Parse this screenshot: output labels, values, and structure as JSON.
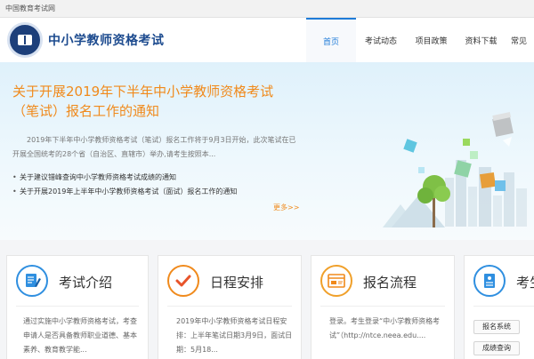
{
  "topbar": {
    "site_name": "中国教育考试网"
  },
  "header": {
    "title": "中小学教师资格考试"
  },
  "nav": {
    "items": [
      "首页",
      "考试动态",
      "项目政策",
      "资料下载",
      "常见"
    ]
  },
  "banner": {
    "headline": "关于开展2019年下半年中小学教师资格考试（笔试）报名工作的通知",
    "summary": "2019年下半年中小学教师资格考试（笔试）报名工作将于9月3日开始，此次笔试在已开展全国统考的28个省（自治区、直辖市）举办,请考生按照本...",
    "news": [
      "关于建议错峰查询中小学教师资格考试成绩的通知",
      "关于开展2019年上半年中小学教师资格考试（面试）报名工作的通知"
    ],
    "more": "更多>>"
  },
  "cards": [
    {
      "title": "考试介绍",
      "text": "通过实施中小学教师资格考试，考查申请人是否具备教师职业道德、基本素养、教育教学能...",
      "icon": "document-edit-icon"
    },
    {
      "title": "日程安排",
      "text": "2019年中小学教师资格考试日程安排：上半年笔试日期3月9日，面试日期：5月18...",
      "icon": "checkmark-icon"
    },
    {
      "title": "报名流程",
      "text": "登录。考生登录“中小学教师资格考试”（http://ntce.neea.edu....",
      "icon": "browser-window-icon"
    },
    {
      "title": "考生",
      "buttons": [
        "报名系统",
        "成绩查询"
      ],
      "icon": "notebook-icon"
    }
  ],
  "colors": {
    "brand_blue": "#1d4b8f",
    "accent_orange": "#f08a1c",
    "nav_active": "#1e7bd8"
  }
}
